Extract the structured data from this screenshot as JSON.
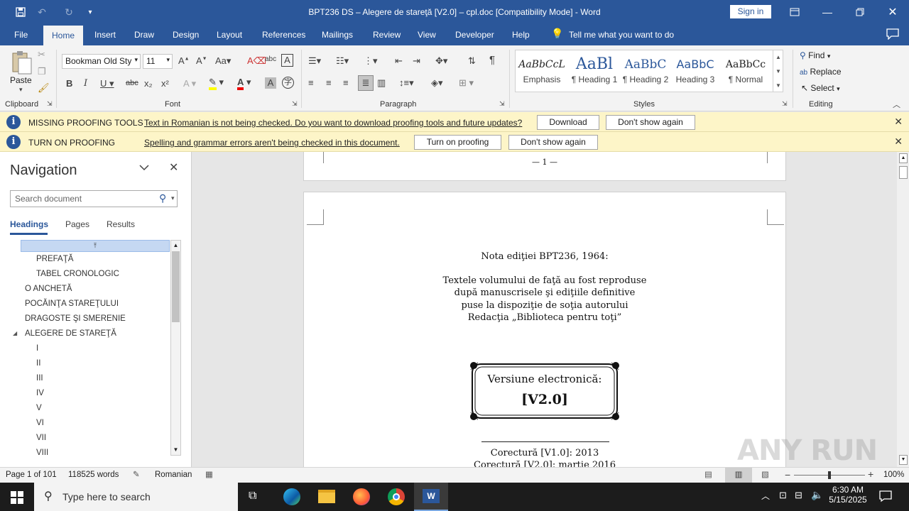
{
  "titlebar": {
    "title": "BPT236 DS – Alegere de stareţă [V2.0] – cpl.doc [Compatibility Mode]  -  Word",
    "sign_in": "Sign in"
  },
  "tabs": [
    "File",
    "Home",
    "Insert",
    "Draw",
    "Design",
    "Layout",
    "References",
    "Mailings",
    "Review",
    "View",
    "Developer",
    "Help"
  ],
  "tell_me": "Tell me what you want to do",
  "ribbon": {
    "paste": "Paste",
    "font_name": "Bookman Old Sty",
    "font_size": "11",
    "styles": [
      {
        "preview": "AaBbCcL",
        "label": "Emphasis"
      },
      {
        "preview": "AaBl",
        "label": "¶ Heading 1"
      },
      {
        "preview": "AaBbC",
        "label": "¶ Heading 2"
      },
      {
        "preview": "AaBbC",
        "label": "Heading 3"
      },
      {
        "preview": "AaBbCc",
        "label": "¶ Normal"
      }
    ],
    "find": "Find",
    "replace": "Replace",
    "select": "Select",
    "groups": {
      "clipboard": "Clipboard",
      "font": "Font",
      "paragraph": "Paragraph",
      "styles": "Styles",
      "editing": "Editing"
    }
  },
  "messages": [
    {
      "title": "MISSING PROOFING TOOLS",
      "text": "Text in Romanian is not being checked. Do you want to download proofing tools and future updates?",
      "btn1": "Download",
      "btn2": "Don't show again"
    },
    {
      "title": "TURN ON PROOFING",
      "text": "Spelling and grammar errors aren't being checked in this document.",
      "btn1": "Turn on proofing",
      "btn2": "Don't show again"
    }
  ],
  "navigation": {
    "title": "Navigation",
    "search_placeholder": "Search document",
    "tabs": [
      "Headings",
      "Pages",
      "Results"
    ],
    "items": [
      {
        "label": "PREFAŢĂ",
        "level": 2
      },
      {
        "label": "TABEL CRONOLOGIC",
        "level": 2
      },
      {
        "label": "O ANCHETĂ",
        "level": 1
      },
      {
        "label": "POCĂINŢA STAREŢULUI",
        "level": 1
      },
      {
        "label": "DRAGOSTE ŞI SMERENIE",
        "level": 1
      },
      {
        "label": "ALEGERE DE STAREŢĂ",
        "level": 1,
        "expanded": true
      },
      {
        "label": "I",
        "level": 2
      },
      {
        "label": "II",
        "level": 2
      },
      {
        "label": "III",
        "level": 2
      },
      {
        "label": "IV",
        "level": 2
      },
      {
        "label": "V",
        "level": 2
      },
      {
        "label": "VI",
        "level": 2
      },
      {
        "label": "VII",
        "level": 2
      },
      {
        "label": "VIII",
        "level": 2
      }
    ]
  },
  "document": {
    "page_number_footer": "— 1 —",
    "edition_note": "Nota ediţiei BPT236, 1964:",
    "lines": [
      "Textele volumului de faţă au fost reproduse",
      "după manuscrisele şi ediţiile definitive",
      "puse la dispoziţie de soţia autorului",
      "Redacţia „Biblioteca pentru toţi”"
    ],
    "frame_title": "Versiune electronică:",
    "frame_version": "[V2.0]",
    "corrections": [
      "Corectură [V1.0]: 2013",
      "Corectură [V2.0]: martie 2016"
    ]
  },
  "watermark": "ANY RUN",
  "status": {
    "page": "Page 1 of 101",
    "words": "118525 words",
    "language": "Romanian",
    "zoom": "100%"
  },
  "taskbar": {
    "search_placeholder": "Type here to search",
    "time": "6:30 AM",
    "date": "5/15/2025"
  }
}
